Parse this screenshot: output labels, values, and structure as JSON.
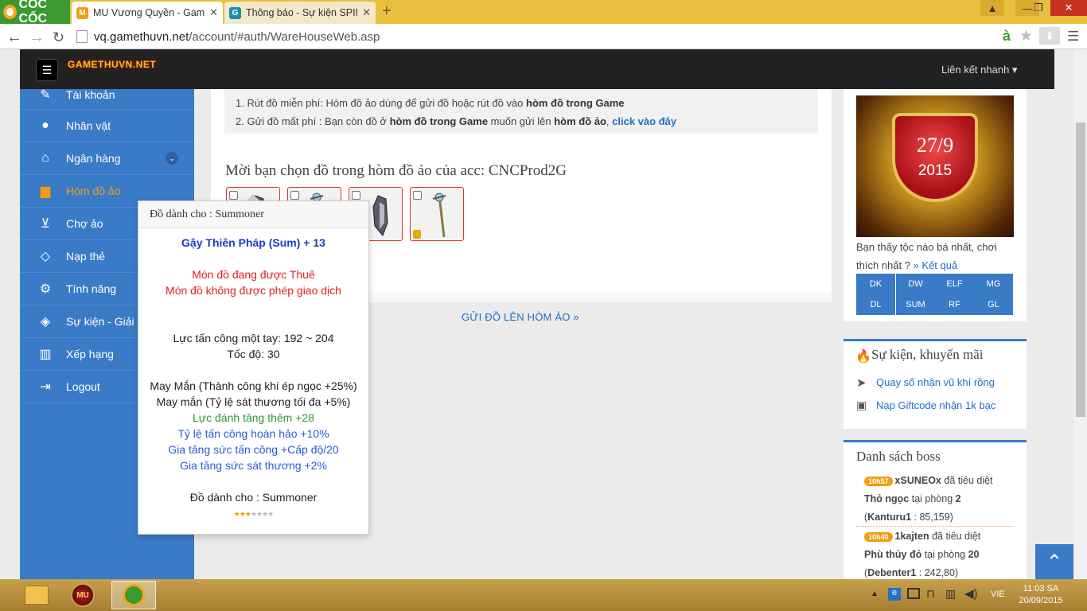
{
  "browser": {
    "logo": "CỐC CỐC",
    "tabs": [
      {
        "title": "MU Vương Quyền - Game",
        "active": true,
        "fav": "MU",
        "favColor": "#f39c12"
      },
      {
        "title": "Thông báo - Sự kiện SPIN",
        "active": false,
        "fav": "G",
        "favColor": "#1c8fa8"
      }
    ],
    "url_domain": "vq.gamethuvn.net",
    "url_path": "/account/#auth/WareHouseWeb.asp"
  },
  "nav": {
    "brand": "GAMETHUVN.NET",
    "brand_bg": "MU",
    "quick": "Liên kết nhanh"
  },
  "sidebar": [
    {
      "label": "Tài khoản",
      "icon": "edit-icon",
      "glyph": "✎"
    },
    {
      "label": "Nhân vật",
      "icon": "user-icon",
      "glyph": "●"
    },
    {
      "label": "Ngân hàng",
      "icon": "bank-icon",
      "glyph": "⌂"
    },
    {
      "label": "Hòm đồ ảo",
      "icon": "briefcase-icon",
      "glyph": "▆"
    },
    {
      "label": "Chợ ảo",
      "icon": "cart-icon",
      "glyph": "🛒"
    },
    {
      "label": "Nạp thẻ",
      "icon": "diamond-icon",
      "glyph": "◇"
    },
    {
      "label": "Tính năng",
      "icon": "gears-icon",
      "glyph": "⚙"
    },
    {
      "label": "Sự kiện - Giải t",
      "icon": "code-icon",
      "glyph": "◈"
    },
    {
      "label": "Xếp hạng",
      "icon": "bar-chart-icon",
      "glyph": "▥"
    },
    {
      "label": "Logout",
      "icon": "logout-icon",
      "glyph": "⇥"
    }
  ],
  "notice": {
    "l1a": "1. Rút đồ miễn phí: Hòm đồ ảo dùng để gửi đồ hoặc rút đồ vào ",
    "l1b": "hòm đồ trong Game",
    "l2a": "2. Gửi đồ mất phí : Bạn còn đồ ở ",
    "l2b": "hòm đồ trong Game",
    "l2c": " muốn gửi lên ",
    "l2d": "hòm đồ ảo",
    "l2e": ", ",
    "l2f": "click vào đây"
  },
  "choose_heading": "Mời bạn chọn đồ trong hòm đồ ảo của acc: CNCProd2G",
  "send_button": "GỬI ĐỒ LÊN HÒM ẢO  »",
  "tooltip": {
    "header": "Đồ dành cho : Summoner",
    "name": "Gậy Thiên Pháp (Sum) + 13",
    "rent": "Món đồ đang được Thuê",
    "notrade": "Món đồ không được phép giao dịch",
    "atk": "Lực tấn công một tay: 192 ~ 204",
    "speed": "Tốc độ: 30",
    "luck1": "May Mắn (Thành công khi ép ngọc +25%)",
    "luck2": "May mắn (Tỷ lệ sát thương tối đa +5%)",
    "opt1": "Lực đánh tăng thêm +28",
    "exc1": "Tỷ lệ tấn công hoàn hảo +10%",
    "exc2": "Gia tăng sức tấn công +Cấp độ/20",
    "exc3": "Gia tăng sức sát thương +2%",
    "footer": "Đồ dành cho : Summoner",
    "stars": "★★★★★★★"
  },
  "right": {
    "date": "27/9",
    "year": "2015",
    "poll_text": "Bạn thấy tộc nào bá nhất, chơi thích nhất ? ",
    "poll_link": "» Kết quả",
    "classes": [
      "DK",
      "DW",
      "ELF",
      "MG",
      "DL",
      "SUM",
      "RF",
      "GL"
    ],
    "events_title": "Sự kiện, khuyến mãi",
    "events": [
      "Quay số nhận vũ khí rồng",
      "Nạp Giftcode nhận 1k bạc"
    ],
    "boss_title": "Danh sách boss",
    "boss": [
      {
        "time": "10h57",
        "player": "xSUNEOx",
        "verb": " đã tiêu diệt",
        "name": "Thỏ ngọc",
        "room_pre": " tại phòng ",
        "room": "2",
        "server": "Kanturu1",
        "coord": " : 85,159)"
      },
      {
        "time": "10h40",
        "player": "1kajten",
        "verb": " đã tiêu diệt",
        "name": "Phù thủy đỏ",
        "room_pre": " tại phòng ",
        "room": "20",
        "server": "Debenter1",
        "coord": " : 242,80)"
      }
    ]
  },
  "clock": {
    "time": "11:03 SA",
    "date": "20/09/2015",
    "lang": "VIE"
  }
}
